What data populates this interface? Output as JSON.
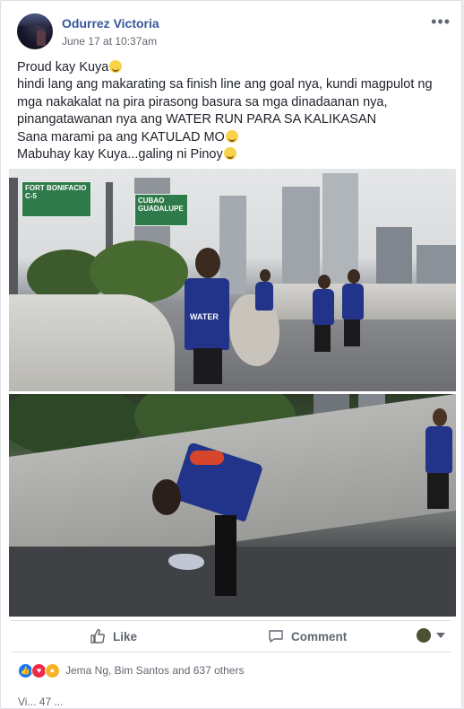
{
  "post": {
    "author": "Odurrez Victoria",
    "timestamp": "June 17 at 10:37am",
    "more_icon": "more-options-icon",
    "lines": [
      "Proud kay Kuya",
      "hindi lang ang makarating sa finish line ang goal nya, kundi magpulot ng",
      "mga nakakalat na pira pirasong basura sa mga dinadaanan nya,",
      "pinangatawanan nya ang WATER RUN PARA SA KALIKASAN",
      "Sana marami pa ang KATULAD MO",
      "Mabuhay kay Kuya...galing ni Pinoy"
    ]
  },
  "photo1": {
    "sign_left": "FORT BONIFACIO C-5",
    "sign_right": "CUBAO GUADALUPE",
    "shirt_text": "WATER"
  },
  "photo2": {},
  "actions": {
    "like_label": "Like",
    "comment_label": "Comment"
  },
  "reactions": {
    "summary": "Jema Ng, Bim Santos and 637 others",
    "types": [
      "like",
      "love",
      "wow"
    ]
  },
  "views": "Vi... 47 ..."
}
